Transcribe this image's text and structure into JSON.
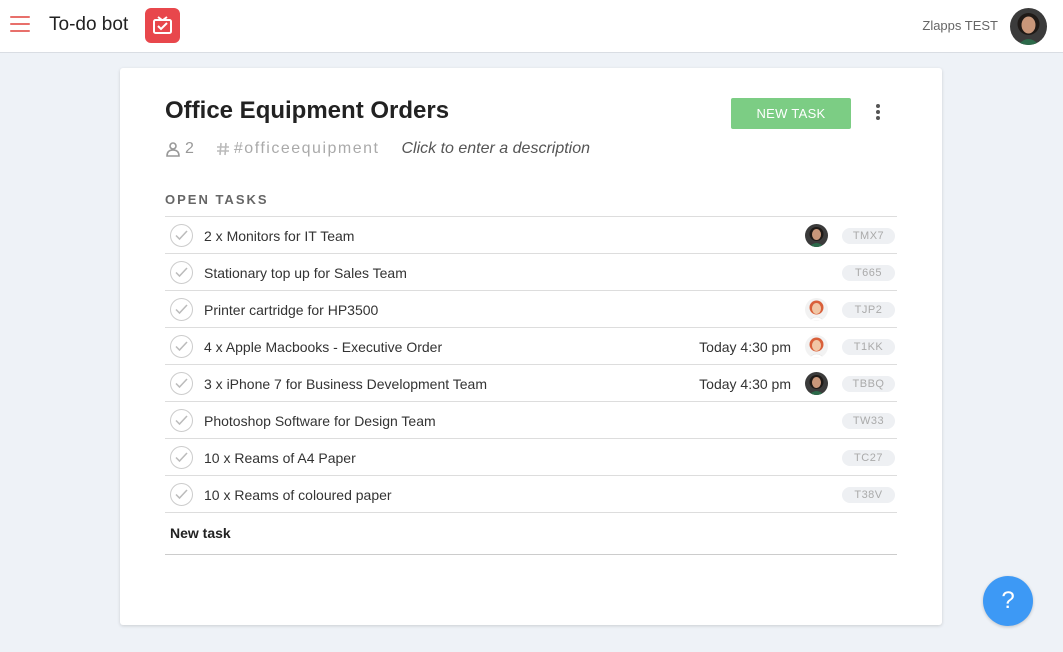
{
  "header": {
    "app_title": "To-do bot",
    "user_name": "Zlapps TEST"
  },
  "list": {
    "title": "Office Equipment Orders",
    "member_count": "2",
    "channel": "#officeequipment",
    "description_placeholder": "Click to enter a description",
    "new_task_button": "NEW TASK",
    "section_label": "OPEN TASKS",
    "new_task_placeholder": "New task"
  },
  "tasks": [
    {
      "title": "2 x Monitors for IT Team",
      "due": "",
      "assignee": "dark-hair-woman",
      "id": "TMX7"
    },
    {
      "title": "Stationary top up for Sales Team",
      "due": "",
      "assignee": "",
      "id": "T665"
    },
    {
      "title": "Printer cartridge for HP3500",
      "due": "",
      "assignee": "redhead-woman",
      "id": "TJP2"
    },
    {
      "title": "4 x Apple Macbooks - Executive Order",
      "due": "Today 4:30 pm",
      "assignee": "redhead-woman",
      "id": "T1KK"
    },
    {
      "title": "3 x iPhone 7 for Business Development Team",
      "due": "Today 4:30 pm",
      "assignee": "dark-hair-woman",
      "id": "TBBQ"
    },
    {
      "title": "Photoshop Software for Design Team",
      "due": "",
      "assignee": "",
      "id": "TW33"
    },
    {
      "title": "10 x Reams of A4 Paper",
      "due": "",
      "assignee": "",
      "id": "TC27"
    },
    {
      "title": "10 x Reams of coloured paper",
      "due": "",
      "assignee": "",
      "id": "T38V"
    }
  ],
  "help": {
    "label": "?"
  },
  "colors": {
    "accent_red": "#e8474c",
    "button_green": "#7ccd84",
    "help_blue": "#3d99f5",
    "background": "#eef2f7"
  },
  "icons": {
    "menu": "hamburger-icon",
    "logo": "app-logo-icon",
    "members": "person-icon",
    "channel": "hash-icon",
    "more": "more-vertical-icon",
    "check": "check-icon"
  }
}
